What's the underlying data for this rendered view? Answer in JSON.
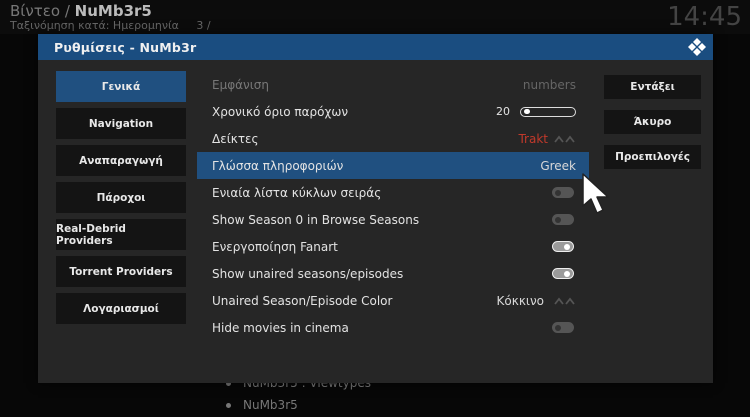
{
  "background": {
    "breadcrumb_prefix": "Βίντεο /",
    "breadcrumb_addon": "NuMb3r5",
    "sort_text": "Ταξινόμηση κατά: Ημερομηνία",
    "sort_count": "3 /",
    "clock": "14:45",
    "list_items": [
      "NuMb3r5 : Viewtypes",
      "NuMb3r5"
    ]
  },
  "dialog": {
    "title": "Ρυθμίσεις - NuMb3r",
    "header_color": "#1a4d80"
  },
  "categories": [
    {
      "label": "Γενικά",
      "active": true
    },
    {
      "label": "Navigation",
      "active": false
    },
    {
      "label": "Αναπαραγωγή",
      "active": false
    },
    {
      "label": "Πάροχοι",
      "active": false
    },
    {
      "label": "Real-Debrid Providers",
      "active": false
    },
    {
      "label": "Torrent Providers",
      "active": false
    },
    {
      "label": "Λογαριασμοί",
      "active": false
    }
  ],
  "settings": [
    {
      "label": "Εμφάνιση",
      "value": "numbers",
      "type": "text",
      "dim": true
    },
    {
      "label": "Χρονικό όριο παρόχων",
      "value": "20",
      "type": "slider",
      "level": 0.05
    },
    {
      "label": "Δείκτες",
      "value": "Trakt",
      "type": "spinner",
      "value_color": "#c0392b"
    },
    {
      "label": "Γλώσσα πληροφοριών",
      "value": "Greek",
      "type": "text",
      "focused": true
    },
    {
      "label": "Ενιαία λίστα κύκλων σειράς",
      "type": "toggle",
      "on": false
    },
    {
      "label": "Show Season 0 in Browse Seasons",
      "type": "toggle",
      "on": false
    },
    {
      "label": "Ενεργοποίηση Fanart",
      "type": "toggle",
      "on": true
    },
    {
      "label": "Show unaired seasons/episodes",
      "type": "toggle",
      "on": true
    },
    {
      "label": "Unaired Season/Episode Color",
      "value": "Κόκκινο",
      "type": "spinner"
    },
    {
      "label": "Hide movies in cinema",
      "type": "toggle",
      "on": false
    }
  ],
  "actions": {
    "ok": "Εντάξει",
    "cancel": "Άκυρο",
    "defaults": "Προεπιλογές"
  }
}
